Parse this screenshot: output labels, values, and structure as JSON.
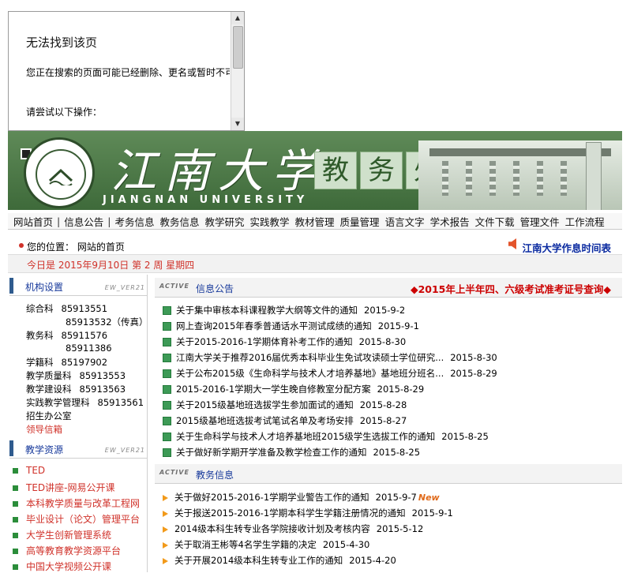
{
  "error_page": {
    "title": "无法找到该页",
    "message": "您正在搜索的页面可能已经删除、更名或暂时不可用。",
    "try_text": "请尝试以下操作："
  },
  "banner": {
    "calligraphy": "江南大学",
    "university_en": "JIANGNAN UNIVERSITY",
    "department": [
      "教",
      "务",
      "处"
    ]
  },
  "nav": {
    "items": [
      "网站首页",
      "信息公告",
      "考务信息",
      "教务信息",
      "教学研究",
      "实践教学",
      "教材管理",
      "质量管理",
      "语言文字",
      "学术报告",
      "文件下载",
      "管理文件",
      "工作流程"
    ]
  },
  "location": {
    "label": "您的位置：",
    "page": "网站的首页",
    "right_link": "江南大学作息时间表"
  },
  "date_bar": {
    "text": "今日是  2015年9月10日  第 2 周  星期四"
  },
  "org": {
    "title": "机构设置",
    "tag": "EW_VER21",
    "rows": [
      {
        "k": "综合科",
        "v": "85913551"
      },
      {
        "k": "",
        "v": "85913532（传真）"
      },
      {
        "k": "教务科",
        "v": "85911576"
      },
      {
        "k": "",
        "v": "85911386"
      },
      {
        "k": "学籍科",
        "v": "85197902"
      },
      {
        "k": "教学质量科",
        "v": "85913553"
      },
      {
        "k": "教学建设科",
        "v": "85913563"
      },
      {
        "k": "实践教学管理科",
        "v": "85913561"
      },
      {
        "k": "招生办公室",
        "v": ""
      }
    ],
    "leader_mail": "领导信箱"
  },
  "resources": {
    "title": "教学资源",
    "tag": "EW_VER21",
    "items": [
      "TED",
      "TED讲座-网易公开课",
      "本科教学质量与改革工程网",
      "毕业设计（论文）管理平台",
      "大学生创新管理系统",
      "高等教育教学资源平台",
      "中国大学视频公开课"
    ]
  },
  "notices": {
    "badge": "ACTIVE",
    "title": "信息公告",
    "right_link": "◆2015年上半年四、六级考试准考证号查询◆",
    "items": [
      {
        "t": "关于集中审核本科课程教学大纲等文件的通知",
        "d": "2015-9-2"
      },
      {
        "t": "网上查询2015年春季普通话水平测试成绩的通知",
        "d": "2015-9-1"
      },
      {
        "t": "关于2015-2016-1学期体育补考工作的通知",
        "d": "2015-8-30"
      },
      {
        "t": "江南大学关于推荐2016届优秀本科毕业生免试攻读硕士学位研究...",
        "d": "2015-8-30"
      },
      {
        "t": "关于公布2015级《生命科学与技术人才培养基地》基地班分班名...",
        "d": "2015-8-29"
      },
      {
        "t": "2015-2016-1学期大一学生晚自修教室分配方案",
        "d": "2015-8-29"
      },
      {
        "t": "关于2015级基地班选拔学生参加面试的通知",
        "d": "2015-8-28"
      },
      {
        "t": "2015级基地班选拔考试笔试名单及考场安排",
        "d": "2015-8-27"
      },
      {
        "t": "关于生命科学与技术人才培养基地班2015级学生选拔工作的通知",
        "d": "2015-8-25"
      },
      {
        "t": "关于做好新学期开学准备及教学检查工作的通知",
        "d": "2015-8-25"
      }
    ]
  },
  "affairs": {
    "badge": "ACTIVE",
    "title": "教务信息",
    "new_label": "New",
    "items": [
      {
        "t": "关于做好2015-2016-1学期学业警告工作的通知",
        "d": "2015-9-7"
      },
      {
        "t": "关于报送2015-2016-1学期本科学生学籍注册情况的通知",
        "d": "2015-9-1"
      },
      {
        "t": "2014级本科生转专业各学院接收计划及考核内容",
        "d": "2015-5-12"
      },
      {
        "t": "关于取消王彬等4名学生学籍的决定",
        "d": "2015-4-30"
      },
      {
        "t": "关于开展2014级本科生转专业工作的通知",
        "d": "2015-4-20"
      }
    ]
  },
  "colors": {
    "banner_green": "#4e7a49",
    "link_blue": "#17399b",
    "alert_red": "#cc0000",
    "date_red": "#d0322a"
  }
}
